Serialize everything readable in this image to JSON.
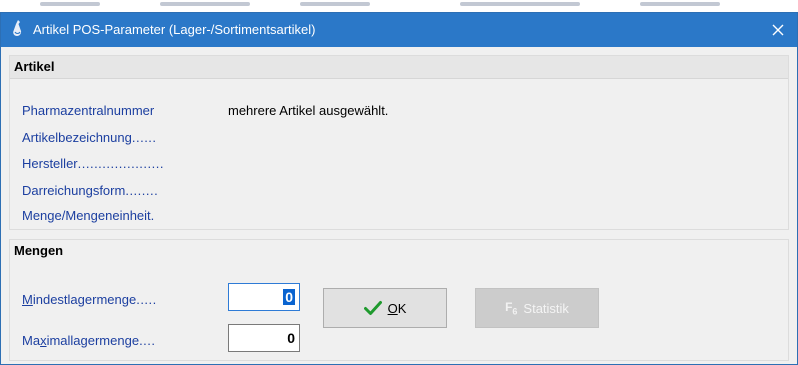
{
  "window": {
    "title": "Artikel POS-Parameter (Lager-/Sortimentsartikel)"
  },
  "artikel": {
    "group_title": "Artikel",
    "fields": [
      {
        "label": "Pharmazentralnummer",
        "dots": "",
        "value": "mehrere Artikel ausgewählt."
      },
      {
        "label": "Artikelbezeichnung",
        "dots": "......",
        "value": ""
      },
      {
        "label": "Hersteller",
        "dots": ".....................",
        "value": ""
      },
      {
        "label": "Darreichungsform",
        "dots": "........",
        "value": ""
      },
      {
        "label": "Menge/Mengeneinheit",
        "dots": ".",
        "value": ""
      }
    ]
  },
  "mengen": {
    "group_title": "Mengen",
    "mindest": {
      "label_u": "M",
      "label_rest": "indestlagermenge",
      "dots": ".....",
      "value": "0"
    },
    "maximal": {
      "label_pre": "Ma",
      "label_u": "x",
      "label_rest": "imallagermenge",
      "dots": "....",
      "value": "0"
    }
  },
  "buttons": {
    "ok": {
      "u": "O",
      "rest": "K"
    },
    "statistik": {
      "key": "F",
      "key_num": "6",
      "label": "Statistik"
    }
  },
  "colors": {
    "titlebar": "#2b78c8",
    "label_blue": "#1c3fa0",
    "selection": "#0a64d0"
  }
}
